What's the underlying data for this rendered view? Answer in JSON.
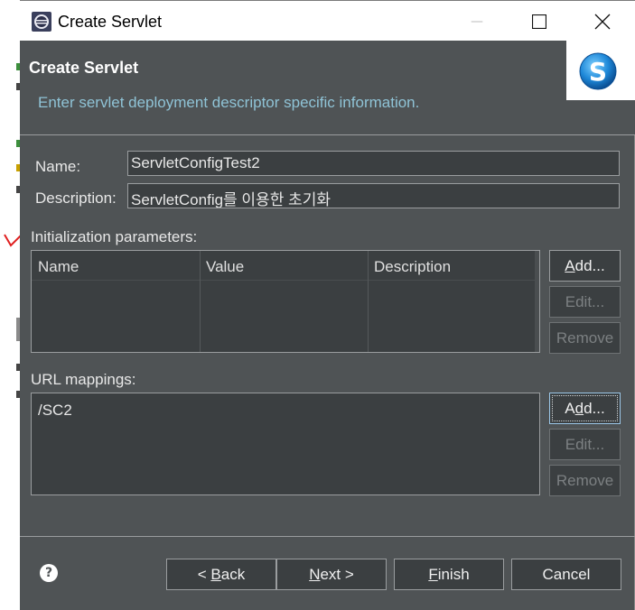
{
  "window": {
    "title": "Create Servlet",
    "minimize_glyph": "—",
    "maximize_glyph": "☐",
    "close_glyph": "✕"
  },
  "header": {
    "title": "Create Servlet",
    "description": "Enter servlet deployment descriptor specific information.",
    "logo_letter": "S"
  },
  "form": {
    "name_label": "Name:",
    "name_value": "ServletConfigTest2",
    "description_label": "Description:",
    "description_value": "ServletConfig를 이용한 초기화"
  },
  "init_params": {
    "label": "Initialization parameters:",
    "columns": [
      "Name",
      "Value",
      "Description"
    ],
    "rows": [],
    "buttons": {
      "add": "Add...",
      "edit": "Edit...",
      "remove": "Remove"
    }
  },
  "url_mappings": {
    "label": "URL mappings:",
    "items": [
      "/SC2"
    ],
    "buttons": {
      "add": "Add...",
      "edit": "Edit...",
      "remove": "Remove"
    }
  },
  "footer": {
    "help_glyph": "?",
    "back": "< Back",
    "next": "Next >",
    "finish": "Finish",
    "cancel": "Cancel"
  },
  "colors": {
    "dialog_bg": "#4f5355",
    "field_bg": "#3b3f41",
    "header_desc": "#8fc3d6",
    "logo_blue": "#1e88d8"
  }
}
